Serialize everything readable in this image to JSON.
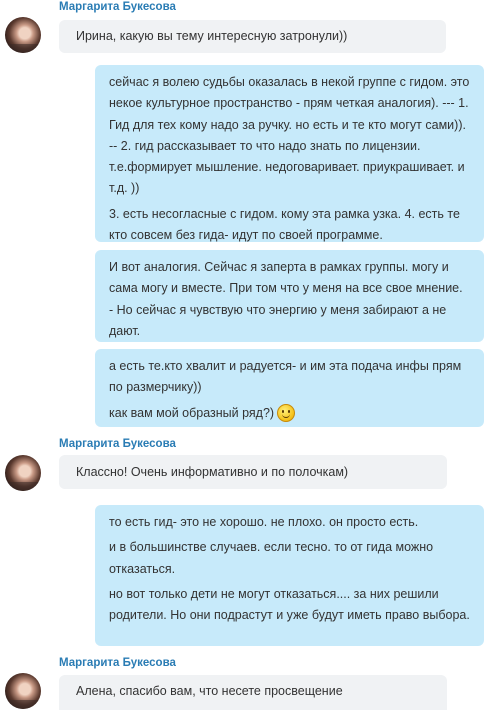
{
  "messages": [
    {
      "sender": "Маргарита Букесова",
      "text": "Ирина, какую вы тему интересную затронули))"
    },
    {
      "paragraphs": [
        "сейчас я волею судьбы оказалась в некой группе с гидом. это некое культурное пространство - прям четкая аналогия). --- 1. Гид для тех кому надо за ручку. но есть и те кто могут сами)). -- 2. гид рассказывает то что надо знать по лицензии. т.е.формирует мышление. недоговаривает. приукрашивает. и т.д. ))",
        "3. есть несогласные с гидом. кому эта рамка узка. 4. есть те кто совсем без гида- идут по своей программе."
      ]
    },
    {
      "paragraphs": [
        "И вот аналогия. Сейчас я заперта в рамках группы. могу и сама могу и вместе. При том что у меня на все свое мнение. - Но сейчас я чувствую что энергию у меня забирают а не дают."
      ]
    },
    {
      "paragraphs": [
        "а есть те.кто хвалит и радуется- и им эта подача инфы прям по размерчику))",
        "как вам мой образный ряд?)"
      ],
      "emoji": "smile-icon"
    },
    {
      "sender": "Маргарита Букесова",
      "text": "Классно! Очень информативно и по полочкам)"
    },
    {
      "paragraphs": [
        "то есть гид- это не хорошо. не плохо. он просто есть.",
        "и в большинстве случаев. если тесно. то от гида можно отказаться.",
        "но вот только дети не могут отказаться.... за них решили родители. Но они подрастут и уже будут иметь право выбора."
      ]
    },
    {
      "sender": "Маргарита Букесова",
      "text": "Алена, спасибо вам, что несете просвещение"
    }
  ]
}
